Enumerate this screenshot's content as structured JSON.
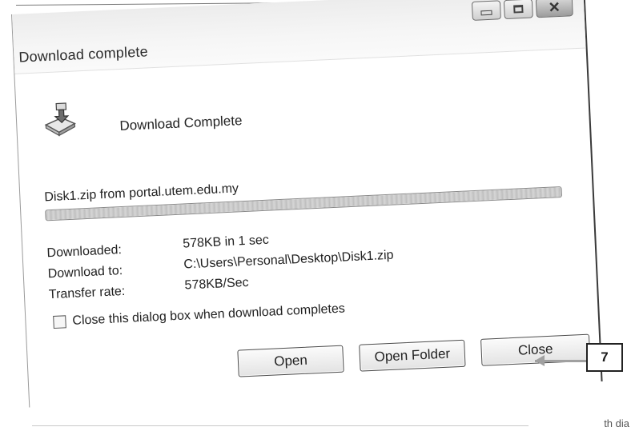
{
  "window": {
    "title": "Download complete",
    "controls": {
      "minimize_icon": "minimize-icon",
      "maximize_icon": "maximize-icon",
      "close_icon": "close-x-icon"
    }
  },
  "dialog": {
    "icon": "download-folder-icon",
    "heading": "Download Complete",
    "source": "Disk1.zip from portal.utem.edu.my",
    "progress": {
      "fraction": 1.0
    },
    "info": [
      {
        "label": "Downloaded:",
        "value": "578KB in 1 sec"
      },
      {
        "label": "Download to:",
        "value": "C:\\Users\\Personal\\Desktop\\Disk1.zip"
      },
      {
        "label": "Transfer rate:",
        "value": "578KB/Sec"
      }
    ],
    "close_on_complete": {
      "label": "Close this dialog box when download completes",
      "checked": false
    },
    "buttons": {
      "open": "Open",
      "open_folder": "Open Folder",
      "close": "Close"
    }
  },
  "annotation": {
    "callout_number": "7"
  },
  "page": {
    "corner_text": "th dia"
  }
}
